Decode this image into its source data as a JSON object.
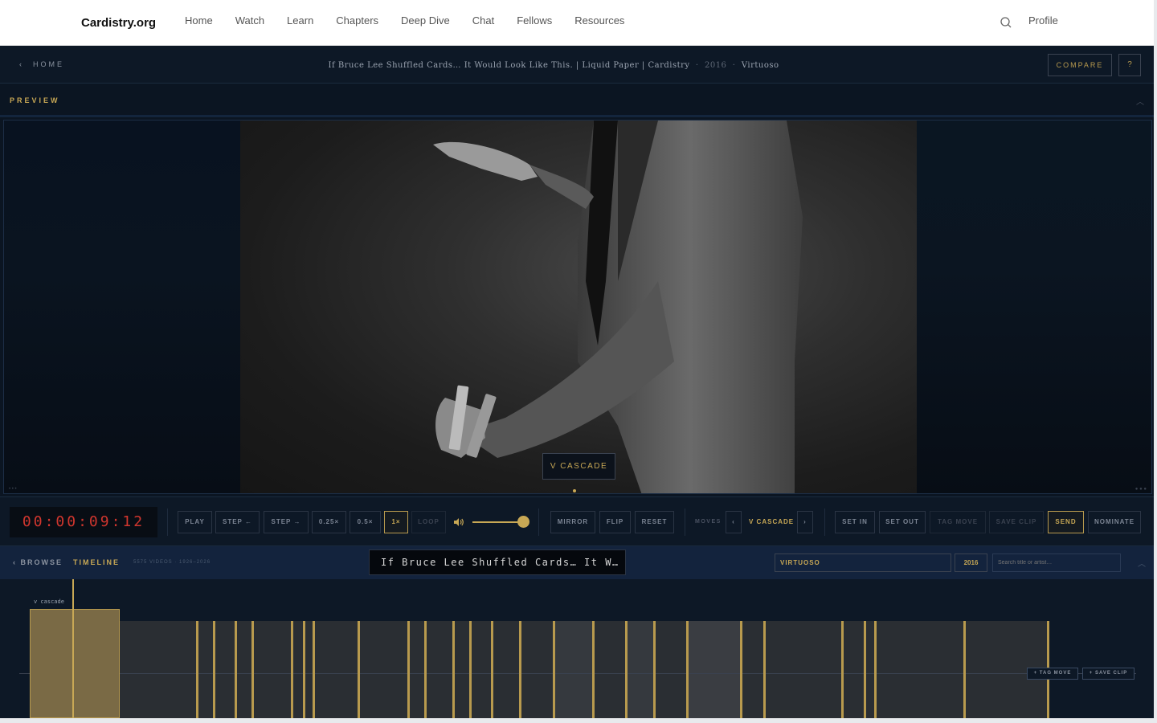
{
  "nav": {
    "brand": "Cardistry.org",
    "links": [
      "Home",
      "Watch",
      "Learn",
      "Chapters",
      "Deep Dive",
      "Chat",
      "Fellows",
      "Resources"
    ],
    "profile": "Profile"
  },
  "header": {
    "home": "HOME",
    "title": "If Bruce Lee Shuffled Cards… It Would Look Like This. | Liquid Paper | Cardistry",
    "year": "2016",
    "level": "Virtuoso",
    "compare": "COMPARE",
    "help": "?"
  },
  "preview": {
    "label": "PREVIEW"
  },
  "video": {
    "move_tag": "V CASCADE"
  },
  "controls": {
    "timecode": "00:00:09:12",
    "play": "PLAY",
    "step_back": "STEP ←",
    "step_fwd": "STEP →",
    "speed_025": "0.25×",
    "speed_05": "0.5×",
    "speed_1": "1×",
    "loop": "LOOP",
    "volume": 1.0,
    "mirror": "MIRROR",
    "flip": "FLIP",
    "reset": "RESET",
    "moves_label": "MOVES",
    "prev_move": "‹",
    "current_move": "V CASCADE",
    "next_move": "›",
    "set_in": "SET IN",
    "set_out": "SET OUT",
    "tag_move": "TAG MOVE",
    "save_clip": "SAVE CLIP",
    "send": "SEND",
    "nominate": "NOMINATE"
  },
  "browse": {
    "back": "BROWSE",
    "timeline": "TIMELINE",
    "meta": "5575 VIDEOS · 1926–2026",
    "now_playing": "If Bruce Lee Shuffled Cards… It W…",
    "filter_level": "VIRTUOSO",
    "filter_year": "2016",
    "search_placeholder": "Search title or artist…"
  },
  "timeline": {
    "selected_label": "v cascade",
    "tag_move": "+ TAG MOVE",
    "save_clip": "+ SAVE CLIP"
  },
  "colors": {
    "accent_gold": "#c8a855",
    "timecode_red": "#d0362e",
    "panel_bg": "#0d1826"
  },
  "icons": {
    "search": "search-icon",
    "volume": "volume-icon",
    "chevron_left": "chevron-left-icon",
    "chevron_up": "chevron-up-icon"
  }
}
